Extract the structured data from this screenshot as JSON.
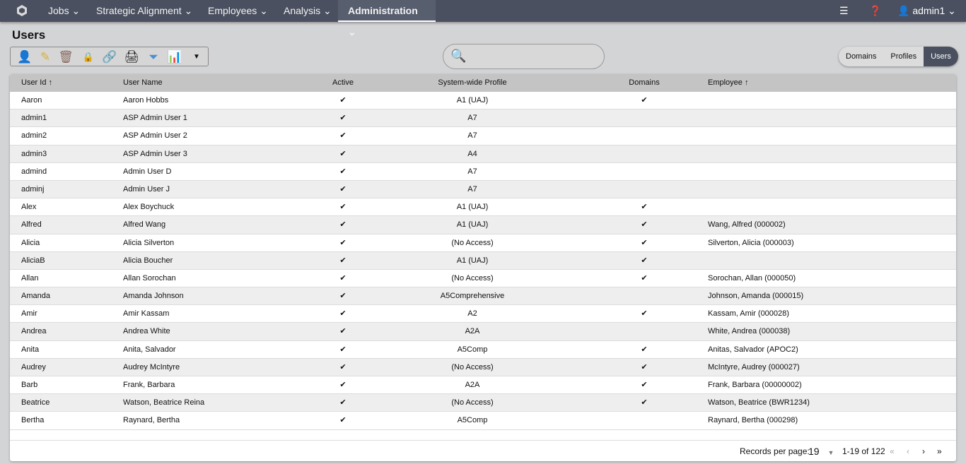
{
  "nav": {
    "items": [
      "Jobs",
      "Strategic Alignment",
      "Employees",
      "Analysis",
      "Administration"
    ],
    "active": "Administration",
    "user": "admin1"
  },
  "page": {
    "title": "Users"
  },
  "toolbar": {
    "icons": [
      "add-user-icon",
      "edit-icon",
      "delete-icon",
      "lock-icon",
      "link-icon",
      "print-icon",
      "filter-icon",
      "report-icon",
      "dropdown-icon"
    ]
  },
  "search": {
    "placeholder": ""
  },
  "segments": [
    "Domains",
    "Profiles",
    "Users"
  ],
  "table": {
    "headers": [
      "User Id",
      "User Name",
      "Active",
      "System-wide Profile",
      "Domains",
      "Employee"
    ],
    "rows": [
      [
        "Aaron",
        "Aaron Hobbs",
        "✔",
        "A1 (UAJ)",
        "✔",
        ""
      ],
      [
        "admin1",
        "ASP Admin User 1",
        "✔",
        "A7",
        "",
        ""
      ],
      [
        "admin2",
        "ASP Admin User 2",
        "✔",
        "A7",
        "",
        ""
      ],
      [
        "admin3",
        "ASP Admin User 3",
        "✔",
        "A4",
        "",
        ""
      ],
      [
        "admind",
        "Admin User D",
        "✔",
        "A7",
        "",
        ""
      ],
      [
        "adminj",
        "Admin User J",
        "✔",
        "A7",
        "",
        ""
      ],
      [
        "Alex",
        "Alex Boychuck",
        "✔",
        "A1 (UAJ)",
        "✔",
        ""
      ],
      [
        "Alfred",
        "Alfred Wang",
        "✔",
        "A1 (UAJ)",
        "✔",
        "Wang, Alfred (000002)"
      ],
      [
        "Alicia",
        "Alicia Silverton",
        "✔",
        "(No Access)",
        "✔",
        "Silverton, Alicia (000003)"
      ],
      [
        "AliciaB",
        "Alicia Boucher",
        "✔",
        "A1 (UAJ)",
        "✔",
        ""
      ],
      [
        "Allan",
        "Allan Sorochan",
        "✔",
        "(No Access)",
        "✔",
        "Sorochan, Allan (000050)"
      ],
      [
        "Amanda",
        "Amanda Johnson",
        "✔",
        "A5Comprehensive",
        "",
        "Johnson, Amanda (000015)"
      ],
      [
        "Amir",
        "Amir Kassam",
        "✔",
        "A2",
        "✔",
        "Kassam, Amir (000028)"
      ],
      [
        "Andrea",
        "Andrea White",
        "✔",
        "A2A",
        "",
        "White, Andrea (000038)"
      ],
      [
        "Anita",
        "Anita, Salvador",
        "✔",
        "A5Comp",
        "✔",
        "Anitas, Salvador (APOC2)"
      ],
      [
        "Audrey",
        "Audrey McIntyre",
        "✔",
        "(No Access)",
        "✔",
        "McIntyre, Audrey (000027)"
      ],
      [
        "Barb",
        "Frank, Barbara",
        "✔",
        "A2A",
        "✔",
        "Frank, Barbara (00000002)"
      ],
      [
        "Beatrice",
        "Watson, Beatrice Reina",
        "✔",
        "(No Access)",
        "✔",
        "Watson, Beatrice (BWR1234)"
      ],
      [
        "Bertha",
        "Raynard, Bertha",
        "✔",
        "A5Comp",
        "",
        "Raynard, Bertha (000298)"
      ]
    ]
  },
  "footer": {
    "records_label": "Records per page:",
    "per_page": "19",
    "range": "1-19 of 122"
  }
}
